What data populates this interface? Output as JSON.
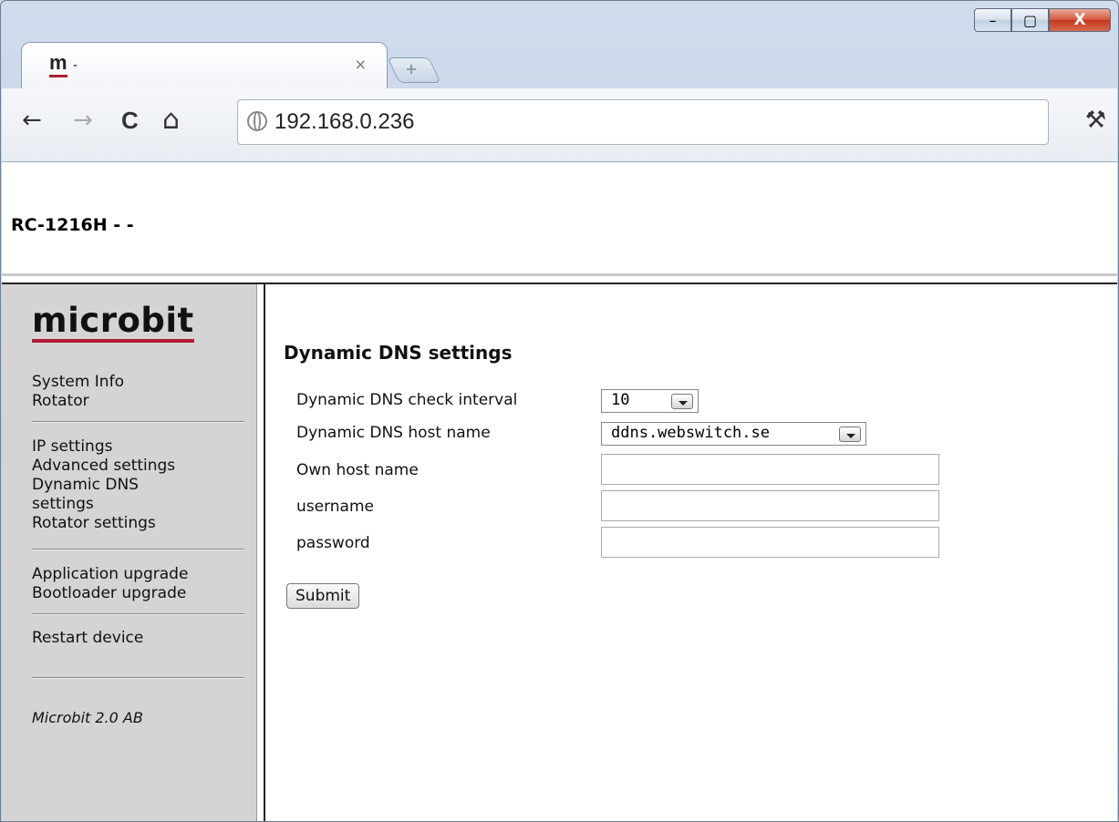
{
  "browser": {
    "tab_title": "-",
    "tab_favicon": "m",
    "tab_close": "×",
    "new_tab": "+",
    "url": "192.168.0.236",
    "nav": {
      "back": "←",
      "forward": "→",
      "reload": "C",
      "home": "⌂",
      "wrench": "⚒"
    },
    "window": {
      "minimize": "–",
      "maximize": "▢",
      "close": "X"
    }
  },
  "page": {
    "device_title": "RC-1216H - -",
    "logo_text": "microbit",
    "sidebar": {
      "group1": [
        "System Info",
        "Rotator"
      ],
      "group2": [
        "IP settings",
        "Advanced settings",
        "Dynamic DNS settings",
        "Rotator settings"
      ],
      "group3": [
        "Application upgrade",
        "Bootloader upgrade"
      ],
      "group4": [
        "Restart device"
      ],
      "copyright": "Microbit 2.0 AB"
    },
    "form": {
      "heading": "Dynamic DNS settings",
      "check_interval_label": "Dynamic DNS check interval",
      "check_interval_value": "10",
      "host_name_label": "Dynamic DNS host name",
      "host_name_value": "ddns.webswitch.se",
      "own_host_label": "Own host name",
      "own_host_value": "",
      "username_label": "username",
      "username_value": "",
      "password_label": "password",
      "password_value": "",
      "submit_label": "Submit"
    }
  }
}
